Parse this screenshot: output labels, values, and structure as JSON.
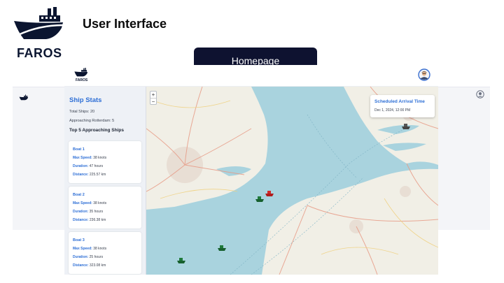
{
  "slide": {
    "logo_text": "FAROS",
    "title": "User Interface",
    "homepage_button": "Homepage"
  },
  "app": {
    "logo_text": "FAROS",
    "sidebar": {
      "title": "Ship Stats",
      "total_ships": "Total Ships: 20",
      "approaching": "Approaching Rotterdam: 5",
      "subtitle": "Top 5 Approaching Ships",
      "boats": [
        {
          "name": "Boat 1",
          "max_speed_label": "Max Speed:",
          "max_speed": "38 knots",
          "duration_label": "Duration:",
          "duration": "47 hours",
          "distance_label": "Distance:",
          "distance": "225.57 km"
        },
        {
          "name": "Boat 2",
          "max_speed_label": "Max Speed:",
          "max_speed": "38 knots",
          "duration_label": "Duration:",
          "duration": "35 hours",
          "distance_label": "Distance:",
          "distance": "236.38 km"
        },
        {
          "name": "Boat 3",
          "max_speed_label": "Max Speed:",
          "max_speed": "38 knots",
          "duration_label": "Duration:",
          "duration": "25 hours",
          "distance_label": "Distance:",
          "distance": "323.08 km"
        }
      ]
    },
    "map": {
      "zoom_in": "+",
      "zoom_out": "−",
      "popup_title": "Scheduled Arrival Time",
      "popup_date": "Dec 1, 2024, 12:00 PM"
    }
  },
  "colors": {
    "navy": "#0e1230",
    "accent_blue": "#2e6fd6",
    "sea": "#a9d3de",
    "land": "#f1efe6",
    "ship_green": "#1f7a3b",
    "ship_red": "#d02a2a"
  }
}
